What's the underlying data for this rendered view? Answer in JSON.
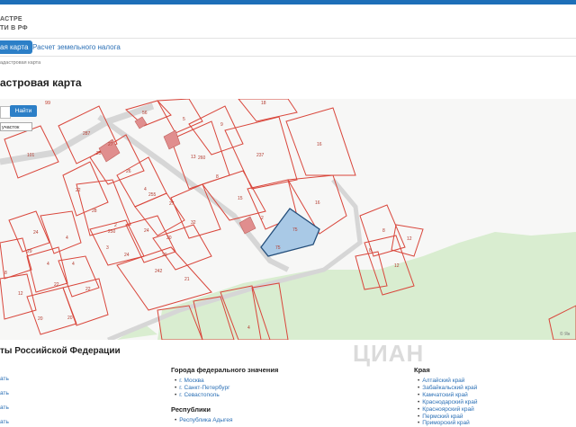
{
  "header": {
    "brand_line1": "АСТРЕ",
    "brand_line2": "ТИ В РФ",
    "tab_active": "ая карта",
    "tab_tax": "Расчет земельного налога"
  },
  "breadcrumb": "адастровая карта",
  "page_title": "астровая карта",
  "map": {
    "search_button": "Найти",
    "type_select": "участок",
    "number_top": "99",
    "attribution": "© Ян",
    "parcel_labels": [
      "99",
      "56",
      "5",
      "18",
      "287",
      "9",
      "101",
      "27",
      "25",
      "26",
      "13",
      "260",
      "237",
      "16",
      "22",
      "4",
      "255",
      "8",
      "16",
      "28",
      "27",
      "15",
      "2",
      "250",
      "24",
      "32",
      "29",
      "4",
      "24",
      "75",
      "8",
      "12",
      "20",
      "3",
      "75",
      "3",
      "4",
      "12",
      "242",
      "12",
      "22",
      "21",
      "20",
      "5",
      "22",
      "6",
      "4",
      "8"
    ]
  },
  "regions": {
    "title": "ты Российской Федерации",
    "left_links": [
      "ать",
      "ать",
      "ать",
      "ать"
    ],
    "federal": {
      "heading": "Города федерального значения",
      "items": [
        "г. Москва",
        "г. Санкт-Петербург",
        "г. Севастополь"
      ]
    },
    "republics": {
      "heading": "Республики",
      "items": [
        "Республика Адыгея"
      ]
    },
    "krai": {
      "heading": "Края",
      "items": [
        "Алтайский край",
        "Забайкальский край",
        "Камчатский край",
        "Краснодарский край",
        "Красноярский край",
        "Пермский край",
        "Приморский край"
      ]
    }
  },
  "watermark": "ЦИАН",
  "colors": {
    "accent": "#2c7fc7",
    "link": "#2a6fb5",
    "parcel": "#d9463b",
    "selected": "#a9c9e6",
    "green": "#dcefd5"
  }
}
